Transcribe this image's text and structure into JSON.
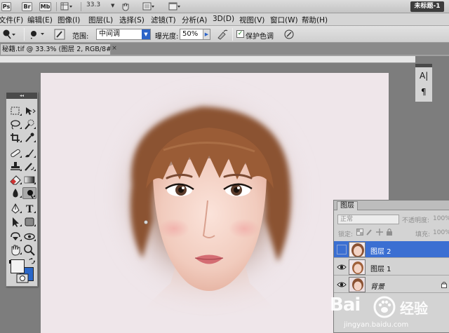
{
  "app_bar": {
    "ps_label": "Ps",
    "br_label": "Br",
    "mb_label": "Mb",
    "zoom_value": "33.3",
    "workspace_label": "未标题-1"
  },
  "menu": {
    "items": [
      "文件(F)",
      "编辑(E)",
      "图像(I)",
      "图层(L)",
      "选择(S)",
      "滤镜(T)",
      "分析(A)",
      "3D(D)",
      "视图(V)",
      "窗口(W)",
      "帮助(H)"
    ]
  },
  "options": {
    "range_label": "范围:",
    "range_value": "中间调",
    "exposure_label": "曝光度:",
    "exposure_value": "50%",
    "protect_label": "保护色调",
    "protect_checked": true
  },
  "document": {
    "tab_title": "秘籍.tif @ 33.3% (图层 2, RGB/8#) *",
    "close_glyph": "×"
  },
  "mini_panel": {
    "char_glyph": "A|",
    "para_glyph": "¶"
  },
  "layers_panel": {
    "tab_label": "图层",
    "blend_mode": "正常",
    "opacity_label": "不透明度:",
    "opacity_value": "100%",
    "lock_label": "锁定:",
    "fill_label": "填充:",
    "fill_value": "100%",
    "layers": [
      {
        "name": "图层 2",
        "selected": true,
        "visible": false,
        "locked": false
      },
      {
        "name": "图层 1",
        "selected": false,
        "visible": true,
        "locked": false
      },
      {
        "name": "背景",
        "selected": false,
        "visible": true,
        "locked": true
      }
    ]
  },
  "tools": {
    "panel_header": "◂◂",
    "icons": [
      "marquee-icon",
      "move-icon",
      "lasso-icon",
      "quick-select-icon",
      "crop-icon",
      "eyedropper-icon",
      "healing-icon",
      "brush-icon",
      "clone-stamp-icon",
      "history-brush-icon",
      "eraser-icon",
      "gradient-icon",
      "blur-icon",
      "dodge-icon",
      "pen-icon",
      "type-icon",
      "path-select-icon",
      "shape-icon",
      "3d-rotate-icon",
      "3d-orbit-icon",
      "hand-icon",
      "zoom-icon"
    ],
    "selected_tool": "dodge-icon",
    "foreground_color": "#f3f3f3",
    "background_color": "#2a67c9"
  },
  "watermark": {
    "brand": "Bai",
    "brand_suffix": "经验",
    "url": "jingyan.baidu.com"
  }
}
